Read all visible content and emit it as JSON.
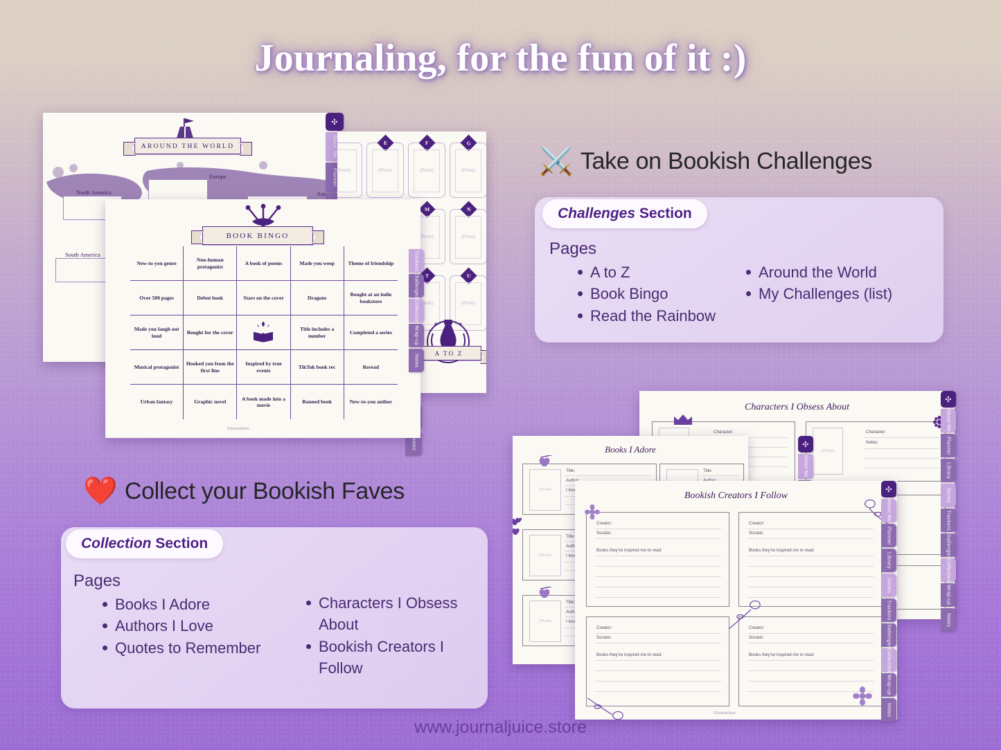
{
  "title": "Journaling, for the fun of it :)",
  "footer": {
    "url": "www.journaljuice.store"
  },
  "challenges": {
    "heading": "Take on Bookish Challenges",
    "emoji": "⚔️",
    "pill_italic": "Challenges",
    "pill_rest": " Section",
    "pages_label": "Pages",
    "pages_col1": [
      "A to Z",
      "Book Bingo",
      "Read the Rainbow"
    ],
    "pages_col2": [
      "Around the World",
      "My Challenges (list)"
    ]
  },
  "collection": {
    "heading": "Collect your Bookish Faves",
    "emoji": "❤️",
    "pill_italic": "Collection",
    "pill_rest": " Section",
    "pages_label": "Pages",
    "pages_col1": [
      "Books I Adore",
      "Authors I Love",
      "Quotes to Remember"
    ],
    "pages_col2": [
      "Characters I Obsess About",
      "Bookish Creators I Follow"
    ]
  },
  "tabs": [
    "About Me",
    "Planner",
    "Library",
    "Series",
    "Trackers",
    "Challenges",
    "Collection",
    "Wrap-up",
    "Notes"
  ],
  "compass_icon": "compass-icon",
  "around_the_world": {
    "banner": "AROUND THE WORLD",
    "regions": [
      "North America",
      "Europe",
      "Asia",
      "South America"
    ]
  },
  "book_bingo": {
    "banner": "BOOK BINGO",
    "copyright": "©JournalJuice",
    "cells": [
      "New-to-you genre",
      "Non-human protagonist",
      "A book of poems",
      "Made you weep",
      "Theme of friendship",
      "Over 500 pages",
      "Debut book",
      "Stars on the cover",
      "Dragons",
      "Bought at an indie bookstore",
      "Made you laugh out loud",
      "Bought for the cover",
      "",
      "Title includes a number",
      "Completed a series",
      "Musical protagonist",
      "Hooked you from the first line",
      "Inspired by true events",
      "TikTok book rec",
      "Reread",
      "Urban fantasy",
      "Graphic novel",
      "A book made into a movie",
      "Banned book",
      "New-to-you author"
    ]
  },
  "a_to_z": {
    "banner": "A TO Z",
    "letters": [
      "E",
      "F",
      "G",
      "M",
      "N",
      "T",
      "U"
    ],
    "photo_placeholder": "(Photo)"
  },
  "characters_page": {
    "title": "Characters I Obsess About",
    "fields": [
      "Character:",
      "Notes:"
    ],
    "photo_placeholder": "(Photo)"
  },
  "books_page": {
    "title": "Books I Adore",
    "fields": [
      "Title:",
      "Author:",
      "I love it..."
    ],
    "photo_placeholder": "(Photo)"
  },
  "creators_page": {
    "title": "Bookish Creators I Follow",
    "fields": [
      "Creator:",
      "Socials:",
      "Books they've inspired me to read:"
    ],
    "copyright": "©JournalJuice"
  },
  "colors": {
    "deep_purple": "#4b2180",
    "accent_purple": "#6c4a9c",
    "card_lavender": "#e4d6f3",
    "page_cream": "#fbf9f3",
    "bg_top": "#ddd0c2",
    "bg_bottom": "#9c6dd4"
  }
}
